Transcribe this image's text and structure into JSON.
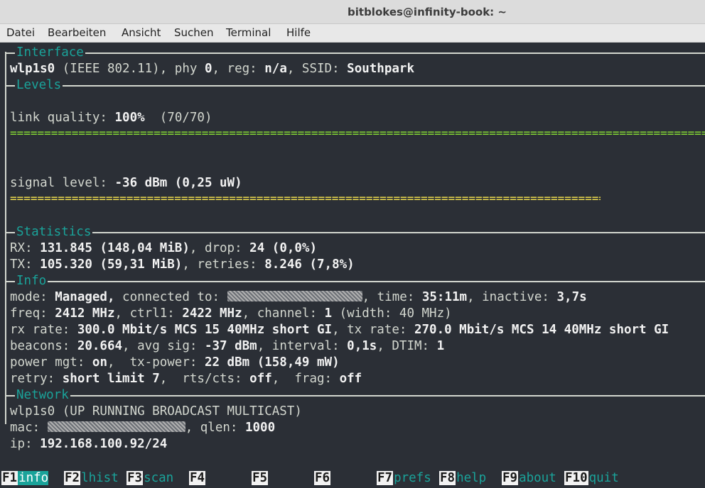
{
  "window": {
    "title": "bitblokes@infinity-book: ~"
  },
  "menu": [
    "Datei",
    "Bearbeiten",
    "Ansicht",
    "Suchen",
    "Terminal",
    "Hilfe"
  ],
  "sections": {
    "interface": "Interface",
    "levels": "Levels",
    "statistics": "Statistics",
    "info": "Info",
    "network": "Network"
  },
  "interface": {
    "name": "wlp1s0",
    "standard": " (IEEE 802.11), phy ",
    "phy": "0",
    "reg_label": ", reg: ",
    "reg": "n/a",
    "ssid_label": ", SSID: ",
    "ssid": "Southpark"
  },
  "levels": {
    "link_label": "link quality: ",
    "link_value": "100%",
    "link_extra": "  (70/70)",
    "link_fraction": 1.0,
    "signal_label": "signal level: ",
    "signal_value": "-36 dBm (0,25 uW)",
    "signal_fraction": 0.85,
    "bar_char": "="
  },
  "statistics": {
    "rx_label": "RX: ",
    "rx_value": "131.845 (148,04 MiB)",
    "drop_label": ", drop: ",
    "drop_value": "24 (0,0%)",
    "tx_label": "TX: ",
    "tx_value": "105.320 (59,31 MiB)",
    "retries_label": ", retries: ",
    "retries_value": "8.246 (7,8%)"
  },
  "info": {
    "mode_label": "mode: ",
    "mode_value": "Managed,",
    "connected_label": " connected to: ",
    "time_label": ", time: ",
    "time_value": "35:11m",
    "inactive_label": ", inactive: ",
    "inactive_value": "3,7s",
    "freq_label": "freq: ",
    "freq_value": "2412 MHz",
    "ctrl_label": ", ctrl1: ",
    "ctrl_value": "2422 MHz",
    "channel_label": ", channel: ",
    "channel_value": "1",
    "width_text": " (width: 40 MHz)",
    "rxrate_label": "rx rate: ",
    "rxrate_value": "300.0 Mbit/s MCS 15 40MHz short GI",
    "txrate_label": ", tx rate: ",
    "txrate_value": "270.0 Mbit/s MCS 14 40MHz short GI",
    "beacons_label": "beacons: ",
    "beacons_value": "20.664",
    "avgsig_label": ", avg sig: ",
    "avgsig_value": "-37 dBm",
    "interval_label": ", interval: ",
    "interval_value": "0,1s",
    "dtim_label": ", DTIM: ",
    "dtim_value": "1",
    "power_label": "power mgt: ",
    "power_value": "on",
    "txpower_label": ",  tx-power: ",
    "txpower_value": "22 dBm (158,49 mW)",
    "retry_label": "retry: ",
    "retry_value": "short limit 7",
    "rts_label": ",  rts/cts: ",
    "rts_value": "off",
    "frag_label": ",  frag: ",
    "frag_value": "off"
  },
  "network": {
    "iface": "wlp1s0",
    "flags": " (UP RUNNING BROADCAST MULTICAST)",
    "mac_label": "mac: ",
    "qlen_label": ", qlen: ",
    "qlen_value": "1000",
    "ip_label": "ip: ",
    "ip_value": "192.168.100.92/24"
  },
  "fkeys": [
    {
      "key": "F1",
      "label": "info"
    },
    {
      "key": "F2",
      "label": "lhist"
    },
    {
      "key": "F3",
      "label": "scan"
    },
    {
      "key": "F4",
      "label": ""
    },
    {
      "key": "F5",
      "label": ""
    },
    {
      "key": "F6",
      "label": ""
    },
    {
      "key": "F7",
      "label": "prefs"
    },
    {
      "key": "F8",
      "label": "help"
    },
    {
      "key": "F9",
      "label": "about"
    },
    {
      "key": "F10",
      "label": "quit"
    }
  ],
  "colors": {
    "accent": "#1aa39a",
    "link_bar": "#8ae234",
    "signal_bar": "#fce94f",
    "background": "#2b2f36"
  }
}
